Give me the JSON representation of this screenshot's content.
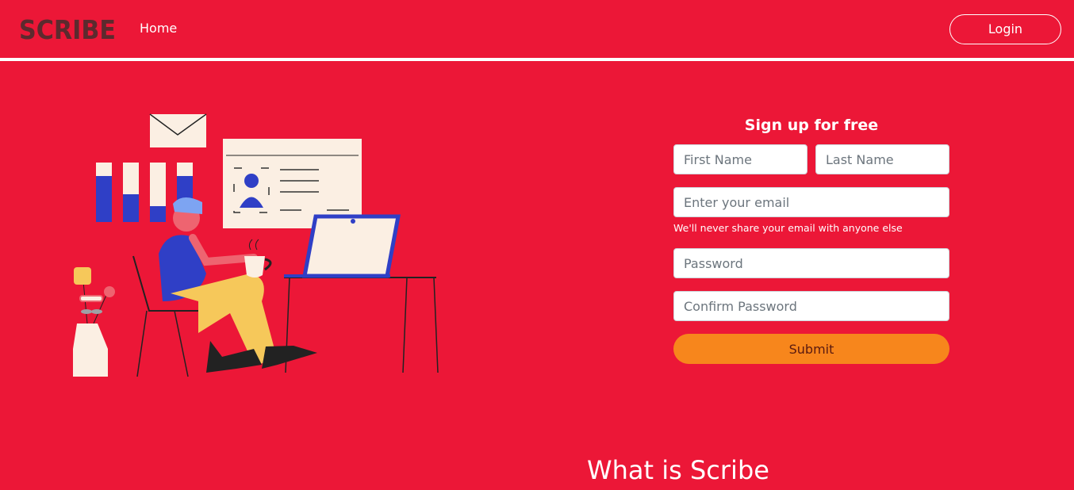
{
  "navbar": {
    "logo_text": "SCRIBE",
    "home_label": "Home",
    "login_label": "Login"
  },
  "signup": {
    "title": "Sign up for free",
    "first_name_placeholder": "First Name",
    "last_name_placeholder": "Last Name",
    "email_placeholder": "Enter your email",
    "email_help": "We'll never share your email with anyone else",
    "password_placeholder": "Password",
    "confirm_password_placeholder": "Confirm Password",
    "submit_label": "Submit"
  },
  "section": {
    "title": "What is Scribe"
  },
  "colors": {
    "background": "#ec1737",
    "submit": "#f7861c",
    "logo": "#5c2a2e",
    "chart_blue": "#2f3fc6",
    "paper": "#fbefe3",
    "pants": "#f6c85a"
  }
}
